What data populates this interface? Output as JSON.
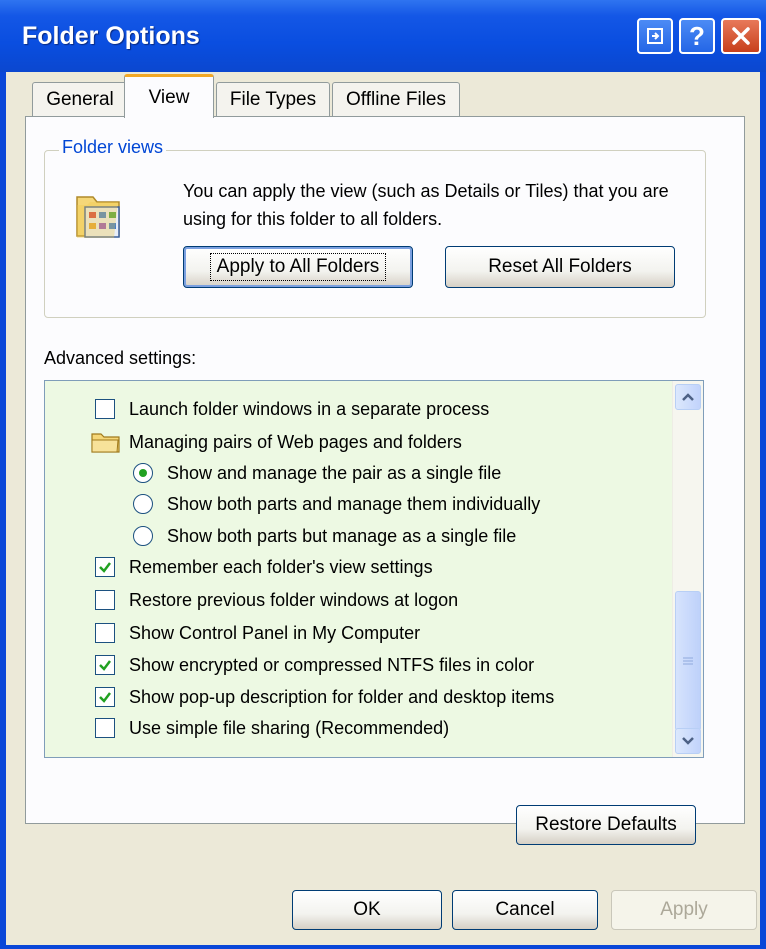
{
  "window": {
    "title": "Folder Options"
  },
  "tabs": [
    {
      "label": "General"
    },
    {
      "label": "View",
      "active": true
    },
    {
      "label": "File Types"
    },
    {
      "label": "Offline Files"
    }
  ],
  "folder_views": {
    "legend": "Folder views",
    "description": "You can apply the view (such as Details or Tiles) that you are using for this folder to all folders.",
    "apply_button": "Apply to All Folders",
    "reset_button": "Reset All Folders"
  },
  "advanced": {
    "label": "Advanced settings:",
    "items": [
      {
        "type": "checkbox",
        "label": "Launch folder windows in a separate process",
        "checked": false
      },
      {
        "type": "folder",
        "label": "Managing pairs of Web pages and folders"
      },
      {
        "type": "radio",
        "label": "Show and manage the pair as a single file",
        "selected": true
      },
      {
        "type": "radio",
        "label": "Show both parts and manage them individually",
        "selected": false
      },
      {
        "type": "radio",
        "label": "Show both parts but manage as a single file",
        "selected": false
      },
      {
        "type": "checkbox",
        "label": "Remember each folder's view settings",
        "checked": true
      },
      {
        "type": "checkbox",
        "label": "Restore previous folder windows at logon",
        "checked": false
      },
      {
        "type": "checkbox",
        "label": "Show Control Panel in My Computer",
        "checked": false
      },
      {
        "type": "checkbox",
        "label": "Show encrypted or compressed NTFS files in color",
        "checked": true
      },
      {
        "type": "checkbox",
        "label": "Show pop-up description for folder and desktop items",
        "checked": true
      },
      {
        "type": "checkbox",
        "label": "Use simple file sharing (Recommended)",
        "checked": false
      }
    ],
    "restore_defaults": "Restore Defaults"
  },
  "footer": {
    "ok": "OK",
    "cancel": "Cancel",
    "apply": "Apply"
  },
  "colors": {
    "title_bar": "#0a4ee0",
    "list_background": "#edf9e3",
    "check_green": "#21a121",
    "legend_blue": "#0046d5"
  }
}
